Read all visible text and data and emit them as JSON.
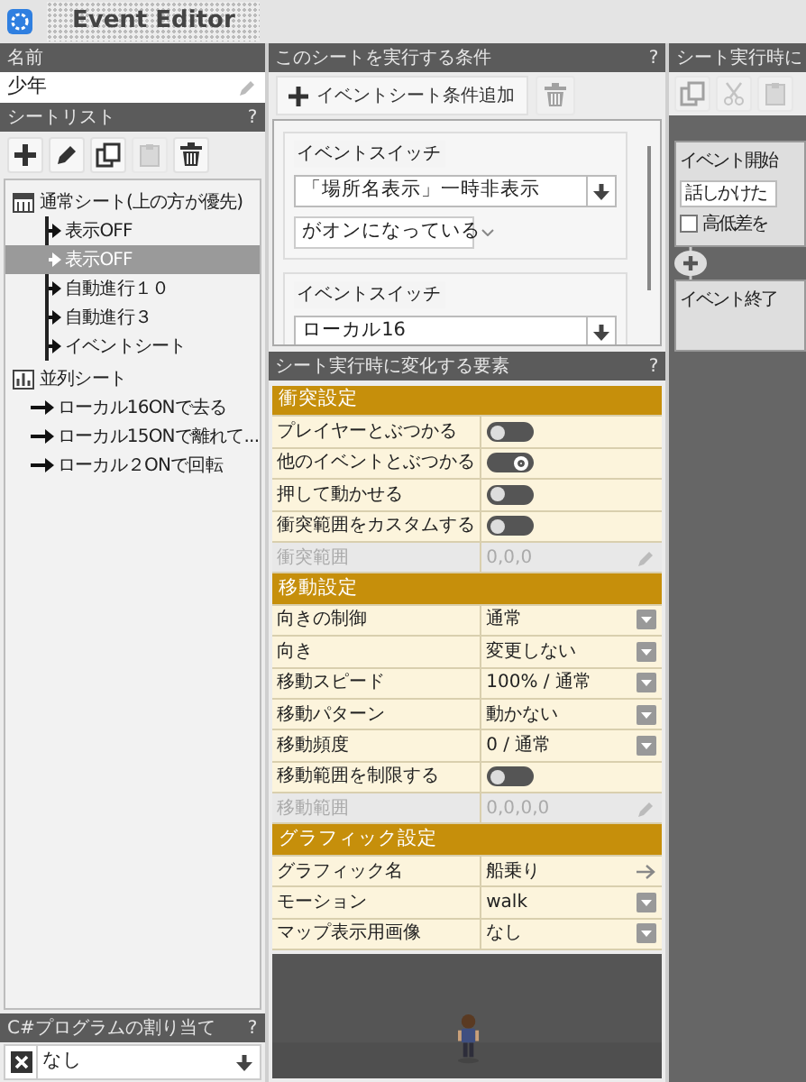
{
  "app": {
    "title": "Event Editor"
  },
  "name_panel": {
    "label": "名前",
    "value": "少年"
  },
  "sheet_list": {
    "title": "シートリスト",
    "help": "?",
    "tools": [
      {
        "kind": "add",
        "disabled": false
      },
      {
        "kind": "edit",
        "disabled": false
      },
      {
        "kind": "copy",
        "disabled": false
      },
      {
        "kind": "paste",
        "disabled": true
      },
      {
        "kind": "delete",
        "disabled": false
      }
    ],
    "tree": [
      {
        "label": "通常シート(上の方が優先)",
        "kind": "normal",
        "children": [
          {
            "label": "表示OFF",
            "selected": false
          },
          {
            "label": "表示OFF",
            "selected": true
          },
          {
            "label": "自動進行１０",
            "selected": false
          },
          {
            "label": "自動進行３",
            "selected": false
          },
          {
            "label": "イベントシート",
            "selected": false
          }
        ]
      },
      {
        "label": "並列シート",
        "kind": "parallel",
        "children": [
          {
            "label": "ローカル16ONで去る",
            "selected": false
          },
          {
            "label": "ローカル15ONで離れて...",
            "selected": false
          },
          {
            "label": "ローカル２ONで回転",
            "selected": false
          }
        ]
      }
    ]
  },
  "csharp": {
    "title": "C#プログラムの割り当て",
    "help": "?",
    "value": "なし"
  },
  "conditions": {
    "title": "このシートを実行する条件",
    "help": "?",
    "add_button": "イベントシート条件追加",
    "delete_disabled": true,
    "items": [
      {
        "title": "イベントスイッチ",
        "switch": "「場所名表示」一時非表示",
        "state": "がオンになっている"
      },
      {
        "title": "イベントスイッチ",
        "switch": "ローカル16"
      }
    ]
  },
  "changes": {
    "title": "シート実行時に変化する要素",
    "help": "?",
    "rows": [
      {
        "kind": "section",
        "label": "衝突設定"
      },
      {
        "kind": "toggle",
        "label": "プレイヤーとぶつかる",
        "on": false
      },
      {
        "kind": "toggle",
        "label": "他のイベントとぶつかる",
        "on": true
      },
      {
        "kind": "toggle",
        "label": "押して動かせる",
        "on": false
      },
      {
        "kind": "toggle",
        "label": "衝突範囲をカスタムする",
        "on": false
      },
      {
        "kind": "text",
        "label": "衝突範囲",
        "value": "0,0,0",
        "disabled": true
      },
      {
        "kind": "section",
        "label": "移動設定"
      },
      {
        "kind": "select",
        "label": "向きの制御",
        "value": "通常"
      },
      {
        "kind": "select",
        "label": "向き",
        "value": "変更しない"
      },
      {
        "kind": "select",
        "label": "移動スピード",
        "value": "100% / 通常"
      },
      {
        "kind": "select",
        "label": "移動パターン",
        "value": "動かない"
      },
      {
        "kind": "select",
        "label": "移動頻度",
        "value": "0 / 通常"
      },
      {
        "kind": "toggle",
        "label": "移動範囲を制限する",
        "on": false
      },
      {
        "kind": "text",
        "label": "移動範囲",
        "value": "0,0,0,0",
        "disabled": true
      },
      {
        "kind": "section",
        "label": "グラフィック設定"
      },
      {
        "kind": "link",
        "label": "グラフィック名",
        "value": "船乗り"
      },
      {
        "kind": "select",
        "label": "モーション",
        "value": "walk"
      },
      {
        "kind": "select",
        "label": "マップ表示用画像",
        "value": "なし"
      }
    ]
  },
  "flow": {
    "title": "シート実行時に",
    "tools": [
      {
        "kind": "copy",
        "disabled": true
      },
      {
        "kind": "cut",
        "disabled": true
      },
      {
        "kind": "paste",
        "disabled": true
      }
    ],
    "start": {
      "title": "イベント開始",
      "trigger": "話しかけた",
      "checkbox": {
        "label": "高低差を",
        "checked": false
      }
    },
    "end": {
      "title": "イベント終了"
    }
  }
}
